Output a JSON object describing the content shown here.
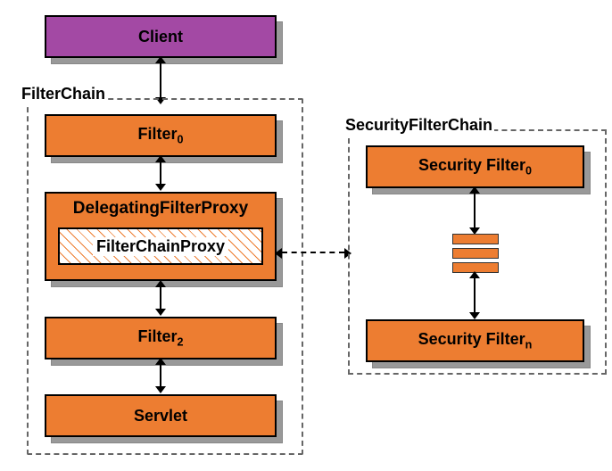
{
  "diagram": {
    "client": "Client",
    "filterChainLabel": "FilterChain",
    "filter0": "Filter",
    "filter0_sub": "0",
    "delegatingFilterProxy": "DelegatingFilterProxy",
    "filterChainProxy": "FilterChainProxy",
    "filter2": "Filter",
    "filter2_sub": "2",
    "servlet": "Servlet",
    "securityFilterChainLabel": "SecurityFilterChain",
    "securityFilter0": "Security Filter",
    "securityFilter0_sub": "0",
    "securityFilterN": "Security Filter",
    "securityFilterN_sub": "n"
  }
}
